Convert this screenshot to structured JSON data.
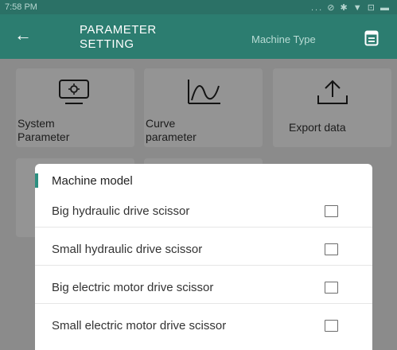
{
  "status_bar": {
    "time": "7:58 PM",
    "icons": "... ⊘ ✱ ▼ ⊡ ▬"
  },
  "app_bar": {
    "back_glyph": "←",
    "title_line1": "PARAMETER",
    "title_line2": "SETTING",
    "machine_type": "Machine Type",
    "icon": "document-icon"
  },
  "tiles": [
    {
      "line1": "System",
      "line2": "Parameter",
      "icon": "monitor-gear-icon"
    },
    {
      "line1": "Curve",
      "line2": "parameter",
      "icon": "curve-icon"
    },
    {
      "line1": "Export data",
      "line2": "",
      "icon": "upload-icon"
    }
  ],
  "dialog": {
    "title": "Machine model",
    "options": [
      {
        "label": "Big hydraulic drive scissor",
        "checked": false
      },
      {
        "label": "Small hydraulic drive scissor",
        "checked": false
      },
      {
        "label": "Big electric motor drive scissor",
        "checked": false
      },
      {
        "label": "Small electric motor drive scissor",
        "checked": false
      }
    ]
  },
  "colors": {
    "primary": "#2c7d70",
    "accent": "#2c8f80",
    "status_bar": "#2b7166"
  }
}
